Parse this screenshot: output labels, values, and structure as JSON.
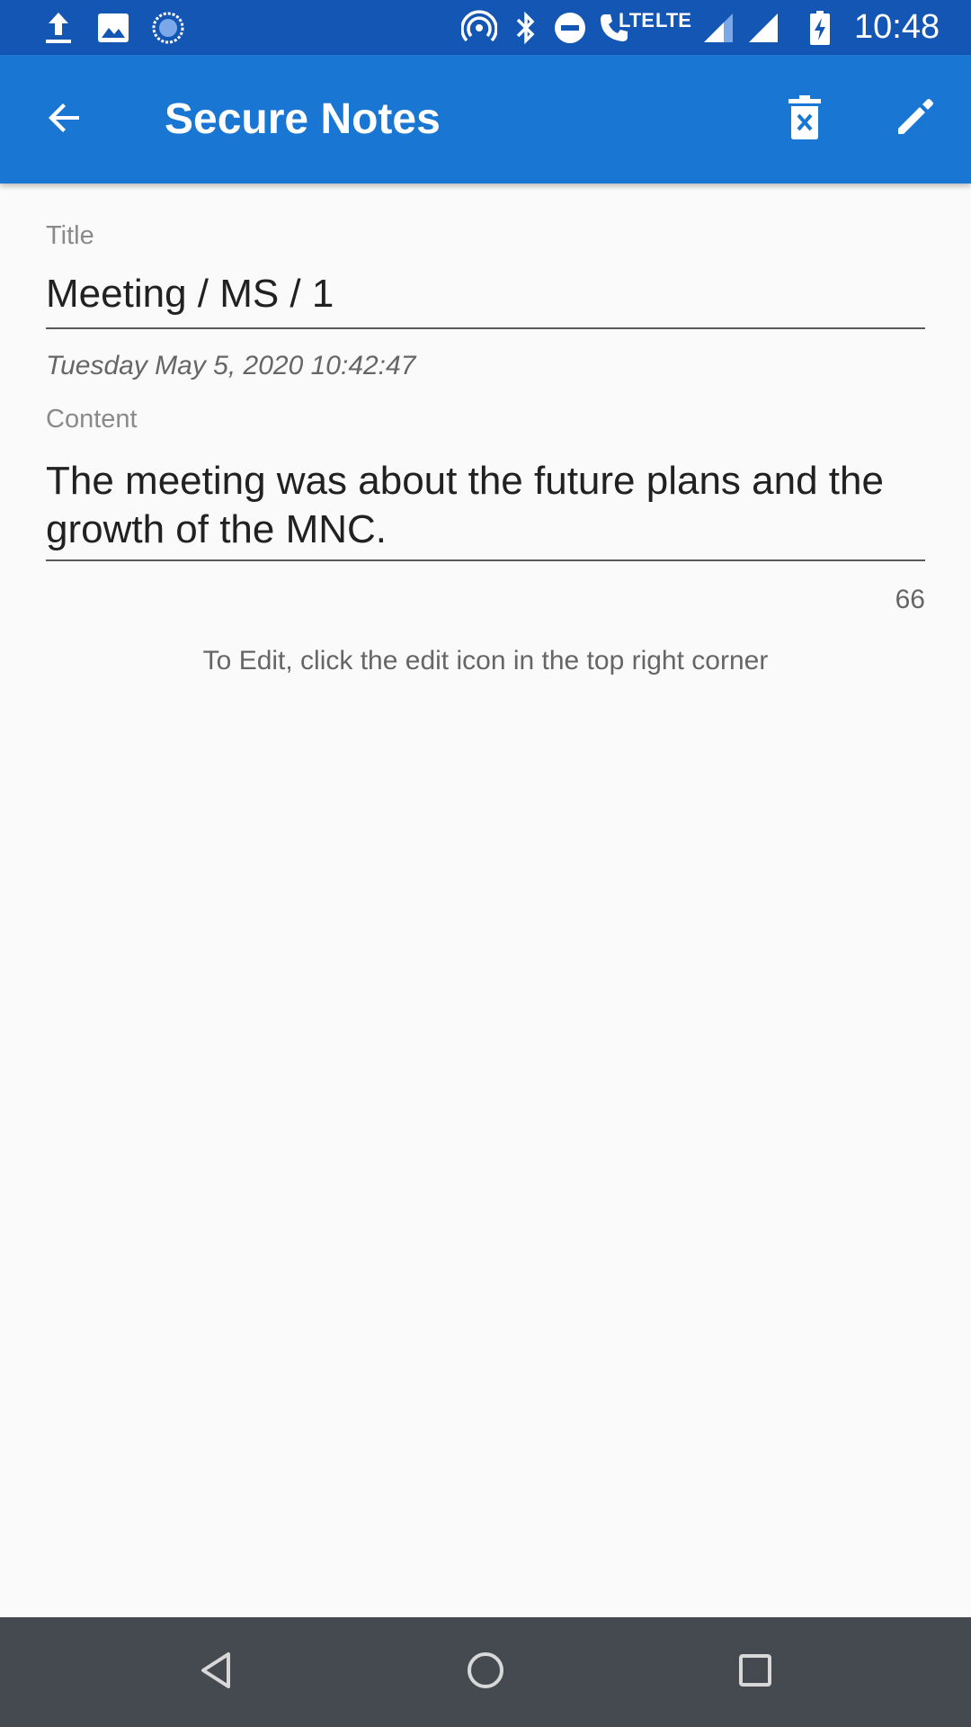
{
  "status_bar": {
    "time": "10:48",
    "lte_call": "LTE",
    "lte_data": "LTE",
    "icons": [
      "upload-icon",
      "image-icon",
      "sync-icon",
      "hotspot-icon",
      "bluetooth-icon",
      "do-not-disturb-icon",
      "volte-call-icon",
      "signal-icon",
      "signal-icon",
      "battery-charging-icon"
    ]
  },
  "app_bar": {
    "title": "Secure Notes",
    "back_icon": "arrow-back-icon",
    "delete_icon": "delete-icon",
    "edit_icon": "edit-icon",
    "color": "#1976d2"
  },
  "note": {
    "title_label": "Title",
    "title_value": "Meeting / MS / 1",
    "timestamp": "Tuesday May 5, 2020 10:42:47",
    "content_label": "Content",
    "content_value": "The meeting was about the future plans and the growth of the MNC.",
    "char_count": "66",
    "hint": "To Edit, click the edit icon in the top right corner"
  },
  "nav_bar": {
    "icons": [
      "back-triangle-icon",
      "home-circle-icon",
      "recents-square-icon"
    ]
  }
}
